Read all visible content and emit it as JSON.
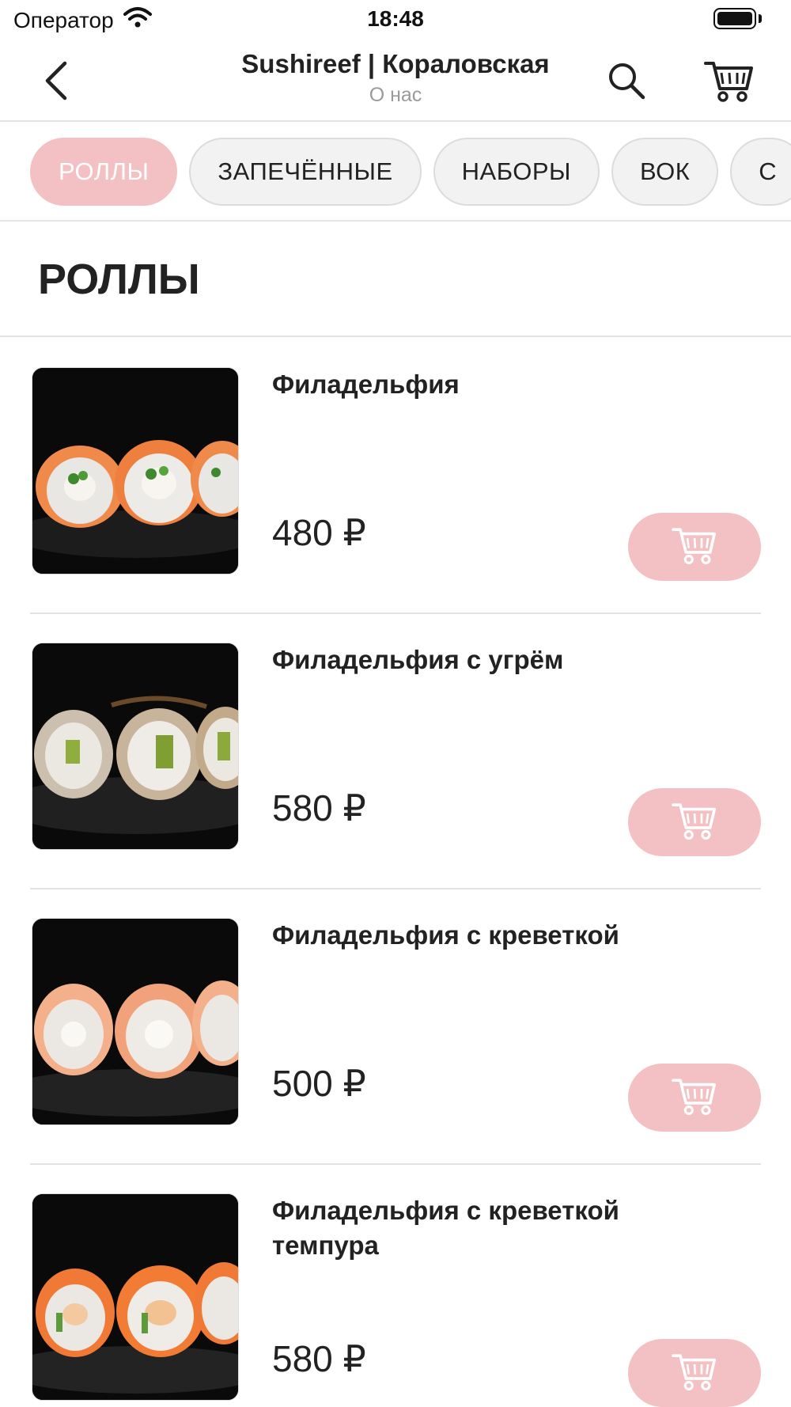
{
  "status_bar": {
    "carrier": "Оператор",
    "time": "18:48"
  },
  "nav": {
    "title": "Sushireef | Кораловская",
    "subtitle": "О нас"
  },
  "categories": [
    {
      "label": "РОЛЛЫ",
      "active": true
    },
    {
      "label": "ЗАПЕЧЁННЫЕ",
      "active": false
    },
    {
      "label": "НАБОРЫ",
      "active": false
    },
    {
      "label": "ВОК",
      "active": false
    },
    {
      "label": "С",
      "active": false
    }
  ],
  "section": {
    "title": "РОЛЛЫ"
  },
  "products": [
    {
      "name": "Филадельфия",
      "price": "480 ₽",
      "image_style": "salmon"
    },
    {
      "name": "Филадельфия с угрём",
      "price": "580 ₽",
      "image_style": "eel"
    },
    {
      "name": "Филадельфия с креветкой",
      "price": "500 ₽",
      "image_style": "shrimp"
    },
    {
      "name": "Филадельфия с креветкой темпура",
      "price": "580 ₽",
      "image_style": "tempura"
    }
  ],
  "colors": {
    "accent": "#f3c1c3",
    "text": "#222222",
    "muted": "#9a9a9a"
  },
  "icons": {
    "back": "chevron-left-icon",
    "search": "search-icon",
    "cart": "cart-icon",
    "add_to_cart": "cart-icon"
  }
}
